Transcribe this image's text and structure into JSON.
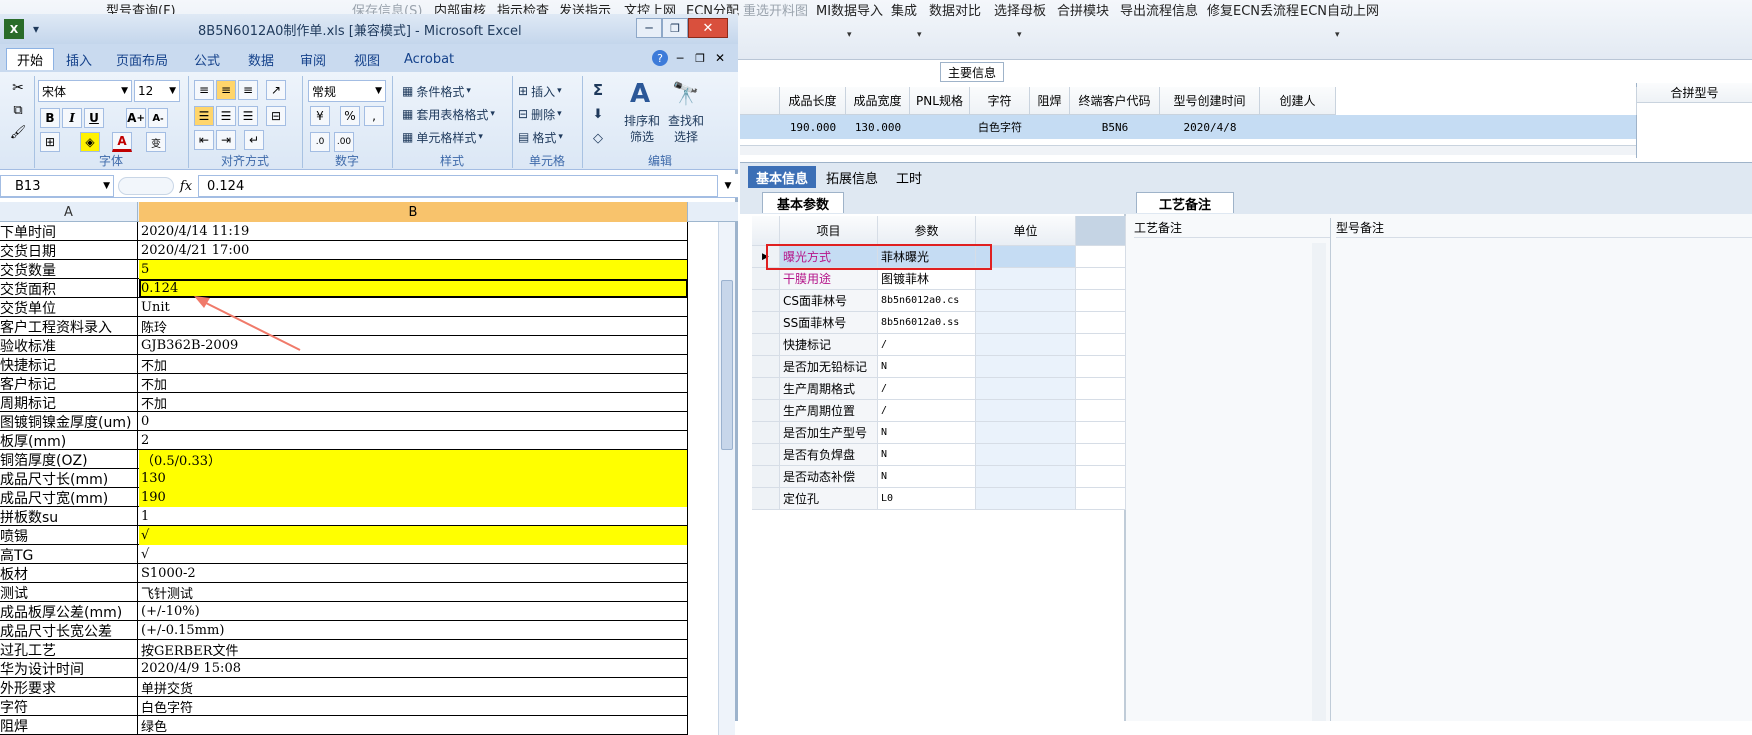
{
  "bg_app": {
    "menu": [
      {
        "label": "型号查询(F)",
        "dim": false
      },
      {
        "label": "保存信息(S)",
        "dim": true
      },
      {
        "label": "内部审核",
        "dim": false
      },
      {
        "label": "指示检查",
        "dim": false
      },
      {
        "label": "发送指示",
        "dim": false
      },
      {
        "label": "文控上网",
        "dim": false
      },
      {
        "label": "ECN分配",
        "dim": false
      },
      {
        "label": "重选开料图",
        "dim": true
      },
      {
        "label": "MI数据导入",
        "dim": false
      },
      {
        "label": "集成",
        "dim": false
      },
      {
        "label": "数据对比",
        "dim": false
      },
      {
        "label": "选择母板",
        "dim": false
      },
      {
        "label": "合拼模块",
        "dim": false
      },
      {
        "label": "导出流程信息",
        "dim": false
      },
      {
        "label": "修复ECN丢流程",
        "dim": false
      },
      {
        "label": "ECN自动上网",
        "dim": false
      }
    ],
    "main_info": {
      "title": "主要信息",
      "headers": [
        "成品长度",
        "成品宽度",
        "PNL规格",
        "字符",
        "阻焊",
        "终端客户代码",
        "型号创建时间",
        "创建人"
      ],
      "values": [
        "190.000",
        "130.000",
        "",
        "白色字符",
        "",
        "B5N6",
        "2020/4/8",
        ""
      ],
      "right_header": "合拼型号"
    },
    "tabs": [
      "基本信息",
      "拓展信息",
      "工时"
    ],
    "basic_params": {
      "title": "基本参数",
      "headers": [
        "项目",
        "参数",
        "单位"
      ],
      "rows": [
        {
          "item": "曝光方式",
          "value": "菲林曝光",
          "highlight": true
        },
        {
          "item": "干膜用途",
          "value": "图镀菲林",
          "highlight": true
        },
        {
          "item": "CS面菲林号",
          "value": "8b5n6012a0.cs"
        },
        {
          "item": "SS面菲林号",
          "value": "8b5n6012a0.ss"
        },
        {
          "item": "快捷标记",
          "value": "/"
        },
        {
          "item": "是否加无铅标记",
          "value": "N"
        },
        {
          "item": "生产周期格式",
          "value": "/"
        },
        {
          "item": "生产周期位置",
          "value": "/"
        },
        {
          "item": "是否加生产型号",
          "value": "N"
        },
        {
          "item": "是否有负焊盘",
          "value": "N"
        },
        {
          "item": "是否动态补偿",
          "value": "N"
        },
        {
          "item": "定位孔",
          "value": "L0"
        }
      ]
    },
    "process_notes": {
      "title": "工艺备注",
      "col1": "工艺备注",
      "col2": "型号备注"
    }
  },
  "excel": {
    "title": "8B5N6012A0制作单.xls  [兼容模式] - Microsoft Excel",
    "ribbon_tabs": [
      "开始",
      "插入",
      "页面布局",
      "公式",
      "数据",
      "审阅",
      "视图",
      "Acrobat"
    ],
    "font_name": "宋体",
    "font_size": "12",
    "number_format": "常规",
    "ribbon_items": {
      "cond_format": "条件格式",
      "table_format": "套用表格格式",
      "cell_style": "单元格样式",
      "insert": "插入",
      "delete": "删除",
      "format": "格式",
      "sort_filter_1": "排序和",
      "sort_filter_2": "筛选",
      "find_select_1": "查找和",
      "find_select_2": "选择"
    },
    "group_labels": [
      "字体",
      "对齐方式",
      "数字",
      "样式",
      "单元格",
      "编辑"
    ],
    "name_box": "B13",
    "formula": "0.124",
    "col_headers": [
      "A",
      "B"
    ],
    "rows": [
      {
        "a": "下单时间",
        "b": "2020/4/14 11:19",
        "yellow": false
      },
      {
        "a": "交货日期",
        "b": "2020/4/21 17:00",
        "yellow": false
      },
      {
        "a": "交货数量",
        "b": "5",
        "yellow": true
      },
      {
        "a": "交货面积",
        "b": "0.124",
        "yellow": true
      },
      {
        "a": "交货单位",
        "b": "Unit",
        "yellow": false
      },
      {
        "a": "客户工程资料录入",
        "b": "陈玲",
        "yellow": false
      },
      {
        "a": "验收标准",
        "b": "GJB362B-2009",
        "yellow": false
      },
      {
        "a": "快捷标记",
        "b": "不加",
        "yellow": false
      },
      {
        "a": "客户标记",
        "b": "不加",
        "yellow": false
      },
      {
        "a": "周期标记",
        "b": "不加",
        "yellow": false
      },
      {
        "a": "图镀铜镍金厚度(um)",
        "b": "0",
        "yellow": false
      },
      {
        "a": "板厚(mm)",
        "b": "2",
        "yellow": false
      },
      {
        "a": "铜箔厚度(OZ)",
        "b": "（0.5/0.33）",
        "yellow": true
      },
      {
        "a": "成品尺寸长(mm)",
        "b": "130",
        "yellow": true
      },
      {
        "a": "成品尺寸宽(mm)",
        "b": "190",
        "yellow": true
      },
      {
        "a": "拼板数su",
        "b": "1",
        "yellow": false
      },
      {
        "a": "喷锡",
        "b": "√",
        "yellow": true
      },
      {
        "a": "高TG",
        "b": "√",
        "yellow": false
      },
      {
        "a": "板材",
        "b": "S1000-2",
        "yellow": false
      },
      {
        "a": "测试",
        "b": "飞针测试",
        "yellow": false
      },
      {
        "a": "成品板厚公差(mm)",
        "b": "(+/-10%)",
        "yellow": false
      },
      {
        "a": "成品尺寸长宽公差",
        "b": "(+/-0.15mm)",
        "yellow": false
      },
      {
        "a": "过孔工艺",
        "b": "按GERBER文件",
        "yellow": false
      },
      {
        "a": "华为设计时间",
        "b": "2020/4/9 15:08",
        "yellow": false
      },
      {
        "a": "外形要求",
        "b": "单拼交货",
        "yellow": false
      },
      {
        "a": "字符",
        "b": "白色字符",
        "yellow": false
      },
      {
        "a": "阻焊",
        "b": "绿色",
        "yellow": false
      }
    ]
  }
}
